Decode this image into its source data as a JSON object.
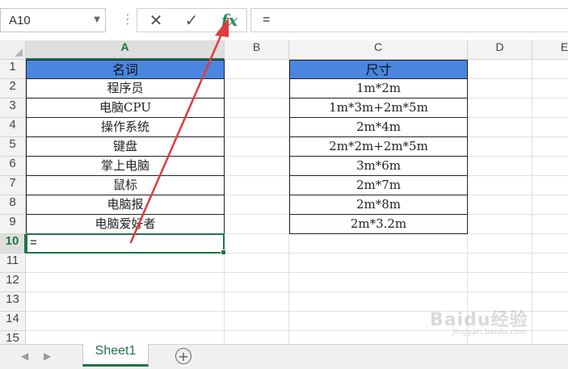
{
  "formula_bar": {
    "name_box": "A10",
    "formula": "=",
    "cancel_glyph": "✕",
    "enter_glyph": "✓",
    "fx_label": "fx",
    "menu_glyph": "⋮"
  },
  "columns": [
    "A",
    "B",
    "C",
    "D",
    "E"
  ],
  "rows": [
    "1",
    "2",
    "3",
    "4",
    "5",
    "6",
    "7",
    "8",
    "9",
    "10",
    "11",
    "12",
    "13",
    "14",
    "15"
  ],
  "table_a": {
    "header": "名词",
    "values": [
      "程序员",
      "电脑CPU",
      "操作系统",
      "键盘",
      "掌上电脑",
      "鼠标",
      "电脑报",
      "电脑爱好者"
    ]
  },
  "table_c": {
    "header": "尺寸",
    "values": [
      "1m*2m",
      "1m*3m+2m*5m",
      "2m*4m",
      "2m*2m+2m*5m",
      "3m*6m",
      "2m*7m",
      "2m*8m",
      "2m*3.2m"
    ]
  },
  "active_cell": {
    "ref": "A10",
    "value": "="
  },
  "sheets": {
    "tab": "Sheet1",
    "add_glyph": "+"
  },
  "watermark": {
    "brand": "Baidu经验",
    "url": "jingyan.baidu.com"
  },
  "colors": {
    "header_fill": "#4a86e0",
    "accent": "#217346",
    "arrow": "#e23b3b"
  }
}
